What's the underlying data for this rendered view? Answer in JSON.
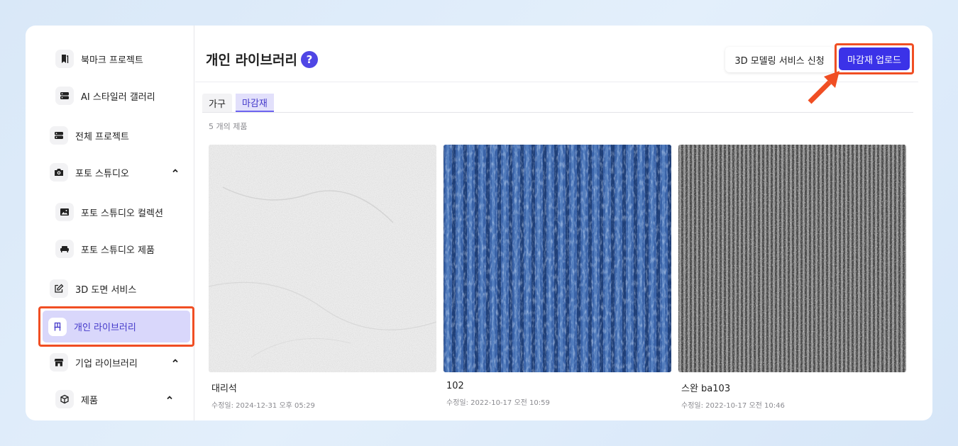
{
  "sidebar": {
    "items": [
      {
        "label": "북마크 프로젝트",
        "icon": "bookmark-icon"
      },
      {
        "label": "AI 스타일러 갤러리",
        "icon": "server-stack-icon"
      },
      {
        "label": "전체 프로젝트",
        "icon": "server-stack-icon"
      },
      {
        "label": "포토 스튜디오",
        "icon": "camera-icon"
      },
      {
        "label": "포토 스튜디오 컬렉션",
        "icon": "image-icon"
      },
      {
        "label": "포토 스튜디오 제품",
        "icon": "sofa-icon"
      },
      {
        "label": "3D 도면 서비스",
        "icon": "edit-icon"
      },
      {
        "label": "개인 라이브러리",
        "icon": "chair-icon"
      },
      {
        "label": "기업 라이브러리",
        "icon": "store-icon"
      },
      {
        "label": "제품",
        "icon": "box-icon"
      }
    ]
  },
  "header": {
    "title": "개인 라이브러리",
    "help": "?",
    "service_button": "3D 모델링 서비스 신청",
    "upload_button": "마감재 업로드"
  },
  "tabs": [
    "가구",
    "마감재"
  ],
  "count_text": "5 개의 제품",
  "products": [
    {
      "name": "대리석",
      "date": "수정일: 2024-12-31 오후 05:29",
      "texture": "marble"
    },
    {
      "name": "102",
      "date": "수정일: 2022-10-17 오전 10:59",
      "texture": "blue-carpet"
    },
    {
      "name": "스완 ba103",
      "date": "수정일: 2022-10-17 오전 10:46",
      "texture": "grey-carpet"
    }
  ],
  "colors": {
    "accent": "#3b32e8",
    "highlight": "#f04e23",
    "active_bg": "#d9d7fb"
  }
}
